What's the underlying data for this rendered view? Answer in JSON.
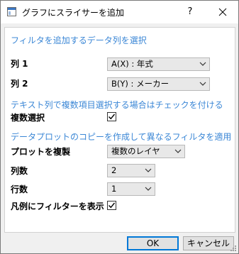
{
  "window": {
    "title": "グラフにスライサーを追加",
    "help_label": "?"
  },
  "section1": {
    "heading": "フィルタを追加するデータ列を選択"
  },
  "col1": {
    "label": "列 1",
    "value": "A(X) : 年式"
  },
  "col2": {
    "label": "列 2",
    "value": "B(Y) : メーカー"
  },
  "section2": {
    "heading": "テキスト列で複数項目選択する場合はチェックを付ける"
  },
  "multi_select": {
    "label": "複数選択",
    "checked": true
  },
  "section3": {
    "heading": "データプロットのコピーを作成して異なるフィルタを適用"
  },
  "copy_plot": {
    "label": "プロットを複製",
    "value": "複数のレイヤ"
  },
  "columns": {
    "label": "列数",
    "value": "2"
  },
  "rows": {
    "label": "行数",
    "value": "1"
  },
  "legend_filter": {
    "label": "凡例にフィルターを表示",
    "checked": true
  },
  "buttons": {
    "ok": "OK",
    "cancel": "キャンセル"
  }
}
